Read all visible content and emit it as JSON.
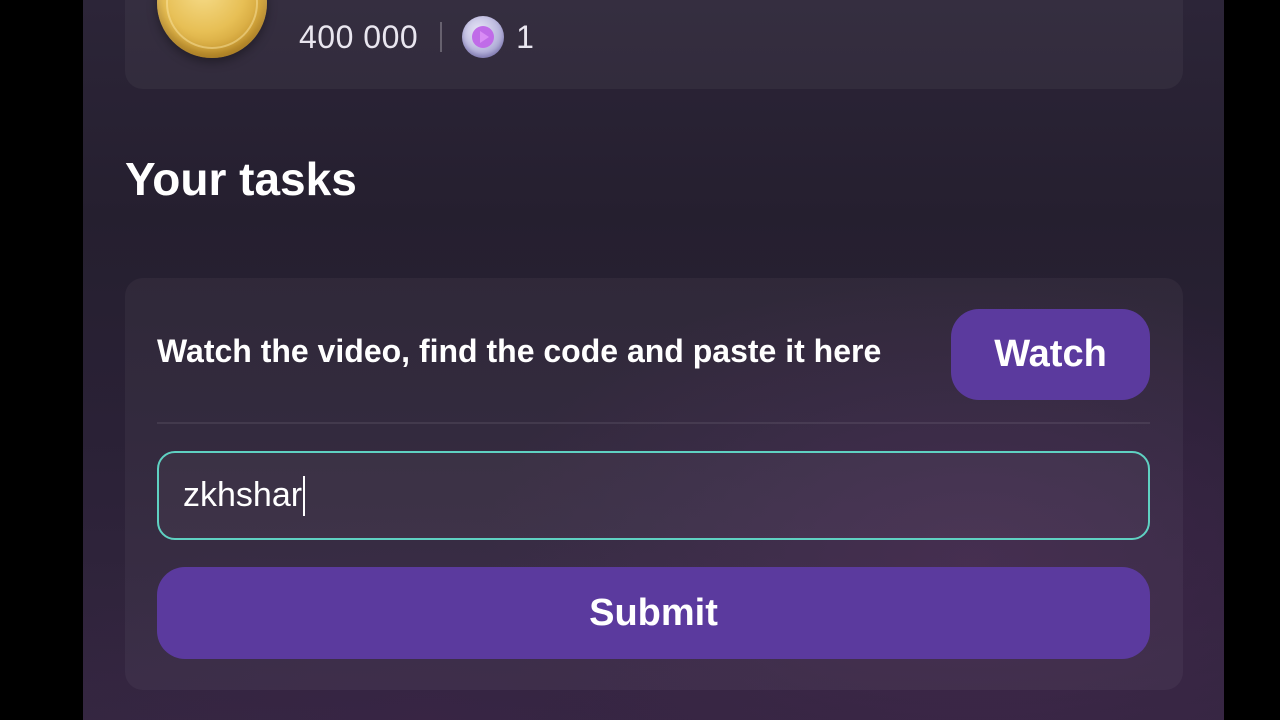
{
  "reward": {
    "coins": "400 000",
    "tickets": "1",
    "coin_icon": "gold-coin-icon",
    "ticket_icon": "play-ticket-icon"
  },
  "tasks_section": {
    "title": "Your tasks"
  },
  "task": {
    "description": "Watch the video, find the code and paste it here",
    "watch_label": "Watch",
    "code_value": "zkhshar",
    "submit_label": "Submit"
  },
  "colors": {
    "accent": "#5b3a9e",
    "input_border": "#5fd1c2",
    "coin": "#e7bf55"
  }
}
